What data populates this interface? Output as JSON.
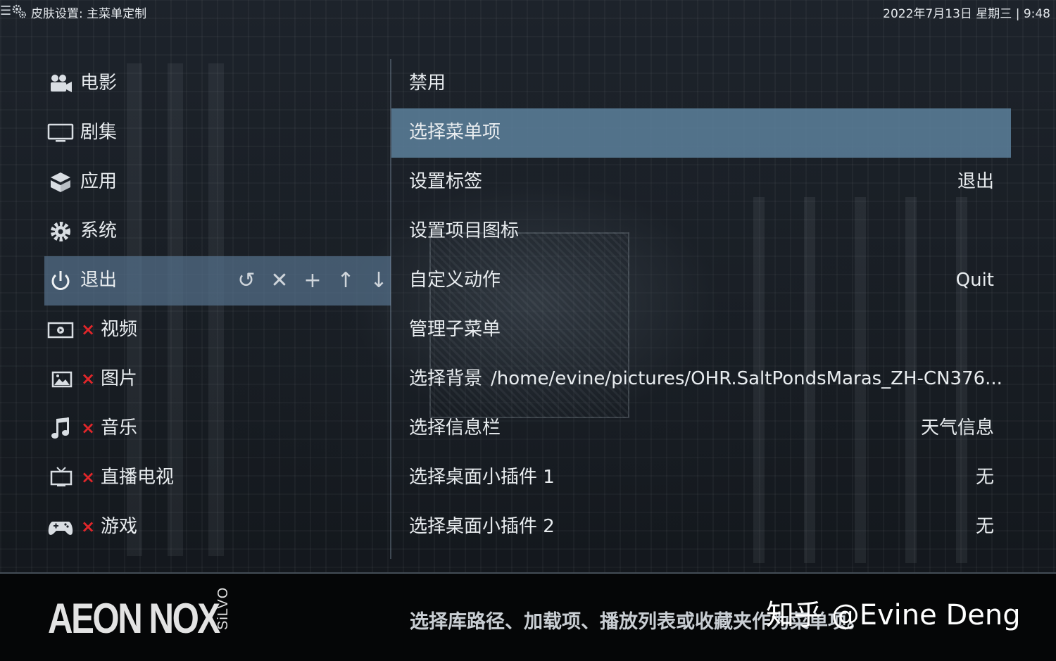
{
  "topbar": {
    "title": "皮肤设置: 主菜单定制",
    "clock": "2022年7月13日 星期三 | 9:48"
  },
  "left_menu": {
    "items": [
      {
        "label": "电影",
        "icon": "movie-camera-icon",
        "disabled": false
      },
      {
        "label": "剧集",
        "icon": "monitor-icon",
        "disabled": false
      },
      {
        "label": "应用",
        "icon": "box-icon",
        "disabled": false
      },
      {
        "label": "系统",
        "icon": "gear-icon",
        "disabled": false
      },
      {
        "label": "退出",
        "icon": "power-icon",
        "disabled": false,
        "active": true
      },
      {
        "label": "视频",
        "icon": "video-icon",
        "disabled": true
      },
      {
        "label": "图片",
        "icon": "picture-icon",
        "disabled": true
      },
      {
        "label": "音乐",
        "icon": "music-note-icon",
        "disabled": true
      },
      {
        "label": "直播电视",
        "icon": "tv-icon",
        "disabled": true
      },
      {
        "label": "游戏",
        "icon": "gamepad-icon",
        "disabled": true
      }
    ],
    "disabled_mark": "×",
    "actions": [
      "↺",
      "✕",
      "+",
      "↑",
      "↓"
    ]
  },
  "right_menu": {
    "items": [
      {
        "label": "禁用",
        "value": ""
      },
      {
        "label": "选择菜单项",
        "value": "",
        "active": true
      },
      {
        "label": "设置标签",
        "value": "退出"
      },
      {
        "label": "设置项目图标",
        "value": ""
      },
      {
        "label": "自定义动作",
        "value": "Quit"
      },
      {
        "label": "管理子菜单",
        "value": ""
      },
      {
        "label": "选择背景",
        "value": "",
        "path": "/home/evine/pictures/OHR.SaltPondsMaras_ZH-CN376..."
      },
      {
        "label": "选择信息栏",
        "value": "天气信息"
      },
      {
        "label": "选择桌面小插件 1",
        "value": "无"
      },
      {
        "label": "选择桌面小插件 2",
        "value": "无"
      }
    ]
  },
  "bottombar": {
    "logo_main": "AEON NOX",
    "logo_sub": "SiLVO",
    "hint": "选择库路径、加载项、播放列表或收藏夹作为菜单项。",
    "watermark": "知乎 @Evine Deng"
  },
  "colors": {
    "highlight": "#5c809b",
    "left_highlight": "#54708a",
    "disabled_mark": "#e0262a"
  }
}
